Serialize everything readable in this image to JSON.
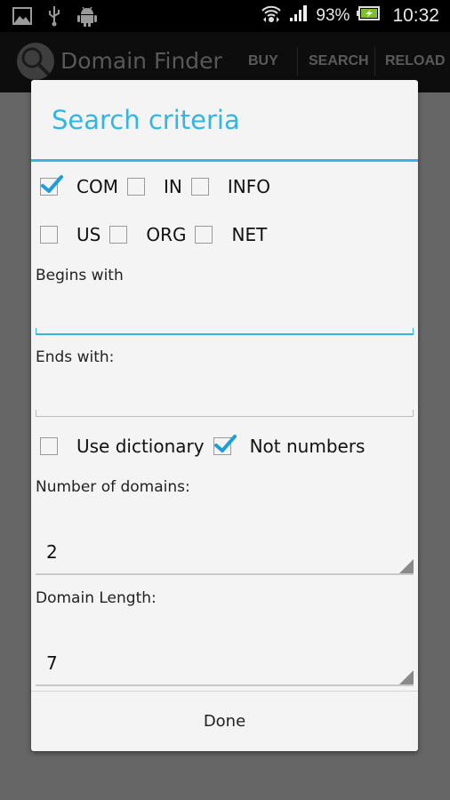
{
  "status_bar": {
    "left_icons": [
      "image-icon",
      "usb-icon",
      "android-icon"
    ],
    "right_icons": [
      "wifi-icon",
      "signal-icon",
      "battery-charging-icon"
    ],
    "battery": "93%",
    "time": "10:32"
  },
  "action_bar": {
    "app_title": "Domain Finder",
    "logo_icon": "magnifier-logo-icon",
    "actions": [
      {
        "label": "BUY"
      },
      {
        "label": "SEARCH"
      },
      {
        "label": "RELOAD"
      }
    ]
  },
  "dialog": {
    "title": "Search criteria",
    "accent_color": "#33b5e5",
    "tld_rows": [
      [
        {
          "label": "COM",
          "checked": true
        },
        {
          "label": "IN",
          "checked": false
        },
        {
          "label": "INFO",
          "checked": false
        }
      ],
      [
        {
          "label": "US",
          "checked": false
        },
        {
          "label": "ORG",
          "checked": false
        },
        {
          "label": "NET",
          "checked": false
        }
      ]
    ],
    "begins_with": {
      "label": "Begins with",
      "value": "",
      "focused": true
    },
    "ends_with": {
      "label": "Ends with:",
      "value": ""
    },
    "options": [
      {
        "label": "Use dictionary",
        "checked": false
      },
      {
        "label": "Not numbers",
        "checked": true
      }
    ],
    "number_of_domains": {
      "label": "Number of domains:",
      "value": "2"
    },
    "domain_length": {
      "label": "Domain Length:",
      "value": "7"
    },
    "done_button": "Done"
  }
}
